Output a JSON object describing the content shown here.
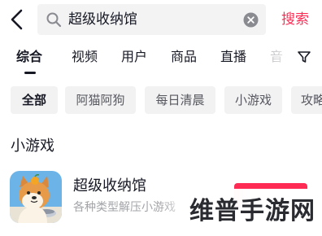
{
  "search": {
    "query": "超级收纳馆",
    "submit_label": "搜索"
  },
  "tabs": [
    {
      "label": "综合"
    },
    {
      "label": "视频"
    },
    {
      "label": "用户"
    },
    {
      "label": "商品"
    },
    {
      "label": "直播"
    },
    {
      "label": "音"
    }
  ],
  "filters": [
    {
      "label": "全部"
    },
    {
      "label": "阿猫阿狗"
    },
    {
      "label": "每日清晨"
    },
    {
      "label": "小游戏"
    },
    {
      "label": "攻略"
    }
  ],
  "section": {
    "title": "小游戏"
  },
  "result": {
    "name": "超级收纳馆",
    "description": "各种类型解压小游戏"
  },
  "watermark": {
    "text": "维普手游网"
  },
  "colors": {
    "accent": "#fe2c55",
    "text_primary": "#161823",
    "text_secondary": "#a3a4a8",
    "chip_bg": "#f2f2f3",
    "search_bg": "#f3f3f4"
  },
  "icons": {
    "back": "chevron-left-icon",
    "search": "search-icon",
    "clear": "clear-icon",
    "filter": "filter-icon",
    "game": "game-app-icon"
  }
}
